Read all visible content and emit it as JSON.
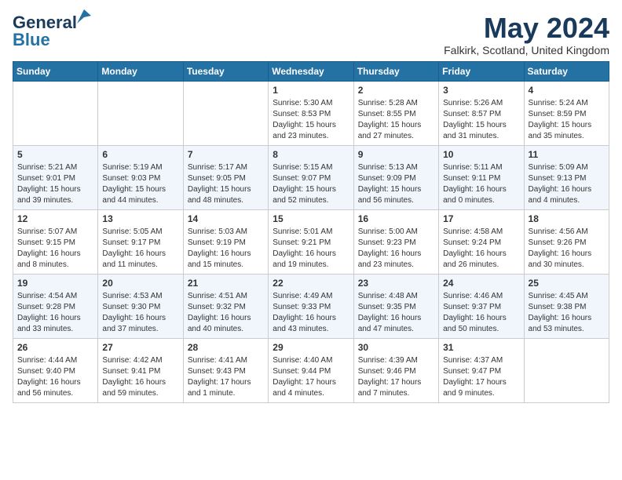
{
  "header": {
    "logo_line1": "General",
    "logo_line2": "Blue",
    "month_title": "May 2024",
    "location": "Falkirk, Scotland, United Kingdom"
  },
  "weekdays": [
    "Sunday",
    "Monday",
    "Tuesday",
    "Wednesday",
    "Thursday",
    "Friday",
    "Saturday"
  ],
  "weeks": [
    [
      {
        "day": "",
        "info": ""
      },
      {
        "day": "",
        "info": ""
      },
      {
        "day": "",
        "info": ""
      },
      {
        "day": "1",
        "info": "Sunrise: 5:30 AM\nSunset: 8:53 PM\nDaylight: 15 hours\nand 23 minutes."
      },
      {
        "day": "2",
        "info": "Sunrise: 5:28 AM\nSunset: 8:55 PM\nDaylight: 15 hours\nand 27 minutes."
      },
      {
        "day": "3",
        "info": "Sunrise: 5:26 AM\nSunset: 8:57 PM\nDaylight: 15 hours\nand 31 minutes."
      },
      {
        "day": "4",
        "info": "Sunrise: 5:24 AM\nSunset: 8:59 PM\nDaylight: 15 hours\nand 35 minutes."
      }
    ],
    [
      {
        "day": "5",
        "info": "Sunrise: 5:21 AM\nSunset: 9:01 PM\nDaylight: 15 hours\nand 39 minutes."
      },
      {
        "day": "6",
        "info": "Sunrise: 5:19 AM\nSunset: 9:03 PM\nDaylight: 15 hours\nand 44 minutes."
      },
      {
        "day": "7",
        "info": "Sunrise: 5:17 AM\nSunset: 9:05 PM\nDaylight: 15 hours\nand 48 minutes."
      },
      {
        "day": "8",
        "info": "Sunrise: 5:15 AM\nSunset: 9:07 PM\nDaylight: 15 hours\nand 52 minutes."
      },
      {
        "day": "9",
        "info": "Sunrise: 5:13 AM\nSunset: 9:09 PM\nDaylight: 15 hours\nand 56 minutes."
      },
      {
        "day": "10",
        "info": "Sunrise: 5:11 AM\nSunset: 9:11 PM\nDaylight: 16 hours\nand 0 minutes."
      },
      {
        "day": "11",
        "info": "Sunrise: 5:09 AM\nSunset: 9:13 PM\nDaylight: 16 hours\nand 4 minutes."
      }
    ],
    [
      {
        "day": "12",
        "info": "Sunrise: 5:07 AM\nSunset: 9:15 PM\nDaylight: 16 hours\nand 8 minutes."
      },
      {
        "day": "13",
        "info": "Sunrise: 5:05 AM\nSunset: 9:17 PM\nDaylight: 16 hours\nand 11 minutes."
      },
      {
        "day": "14",
        "info": "Sunrise: 5:03 AM\nSunset: 9:19 PM\nDaylight: 16 hours\nand 15 minutes."
      },
      {
        "day": "15",
        "info": "Sunrise: 5:01 AM\nSunset: 9:21 PM\nDaylight: 16 hours\nand 19 minutes."
      },
      {
        "day": "16",
        "info": "Sunrise: 5:00 AM\nSunset: 9:23 PM\nDaylight: 16 hours\nand 23 minutes."
      },
      {
        "day": "17",
        "info": "Sunrise: 4:58 AM\nSunset: 9:24 PM\nDaylight: 16 hours\nand 26 minutes."
      },
      {
        "day": "18",
        "info": "Sunrise: 4:56 AM\nSunset: 9:26 PM\nDaylight: 16 hours\nand 30 minutes."
      }
    ],
    [
      {
        "day": "19",
        "info": "Sunrise: 4:54 AM\nSunset: 9:28 PM\nDaylight: 16 hours\nand 33 minutes."
      },
      {
        "day": "20",
        "info": "Sunrise: 4:53 AM\nSunset: 9:30 PM\nDaylight: 16 hours\nand 37 minutes."
      },
      {
        "day": "21",
        "info": "Sunrise: 4:51 AM\nSunset: 9:32 PM\nDaylight: 16 hours\nand 40 minutes."
      },
      {
        "day": "22",
        "info": "Sunrise: 4:49 AM\nSunset: 9:33 PM\nDaylight: 16 hours\nand 43 minutes."
      },
      {
        "day": "23",
        "info": "Sunrise: 4:48 AM\nSunset: 9:35 PM\nDaylight: 16 hours\nand 47 minutes."
      },
      {
        "day": "24",
        "info": "Sunrise: 4:46 AM\nSunset: 9:37 PM\nDaylight: 16 hours\nand 50 minutes."
      },
      {
        "day": "25",
        "info": "Sunrise: 4:45 AM\nSunset: 9:38 PM\nDaylight: 16 hours\nand 53 minutes."
      }
    ],
    [
      {
        "day": "26",
        "info": "Sunrise: 4:44 AM\nSunset: 9:40 PM\nDaylight: 16 hours\nand 56 minutes."
      },
      {
        "day": "27",
        "info": "Sunrise: 4:42 AM\nSunset: 9:41 PM\nDaylight: 16 hours\nand 59 minutes."
      },
      {
        "day": "28",
        "info": "Sunrise: 4:41 AM\nSunset: 9:43 PM\nDaylight: 17 hours\nand 1 minute."
      },
      {
        "day": "29",
        "info": "Sunrise: 4:40 AM\nSunset: 9:44 PM\nDaylight: 17 hours\nand 4 minutes."
      },
      {
        "day": "30",
        "info": "Sunrise: 4:39 AM\nSunset: 9:46 PM\nDaylight: 17 hours\nand 7 minutes."
      },
      {
        "day": "31",
        "info": "Sunrise: 4:37 AM\nSunset: 9:47 PM\nDaylight: 17 hours\nand 9 minutes."
      },
      {
        "day": "",
        "info": ""
      }
    ]
  ]
}
